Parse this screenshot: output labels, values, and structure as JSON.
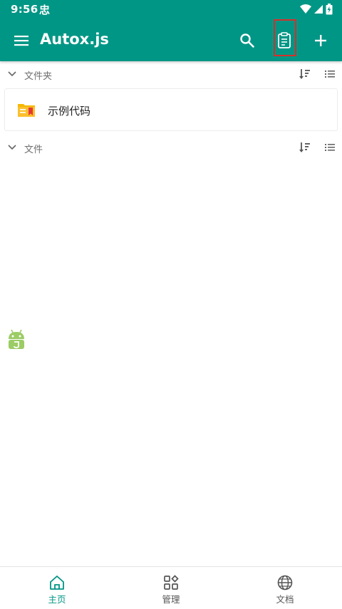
{
  "status_bar": {
    "time": "9:56",
    "notification_glyph": "忠",
    "icons": [
      "wifi-icon",
      "cell-signal-icon",
      "battery-charging-icon"
    ]
  },
  "toolbar": {
    "title": "Autox.js",
    "actions": [
      "search-icon",
      "log-icon",
      "add-icon"
    ],
    "highlighted_action": "log-icon"
  },
  "sections": {
    "folders": {
      "title": "文件夹",
      "items": [
        {
          "name": "示例代码",
          "icon": "folder-icon"
        }
      ]
    },
    "files": {
      "title": "文件",
      "items": []
    }
  },
  "bottom_nav": {
    "items": [
      {
        "label": "主页",
        "icon": "home-icon",
        "active": true
      },
      {
        "label": "管理",
        "icon": "grid-icon",
        "active": false
      },
      {
        "label": "文档",
        "icon": "globe-icon",
        "active": false
      }
    ]
  },
  "colors": {
    "primary": "#009685",
    "highlight": "#d6302a",
    "folder": "#f5b800",
    "folder_tab": "#e53935",
    "android_float": "#9ccc65"
  }
}
